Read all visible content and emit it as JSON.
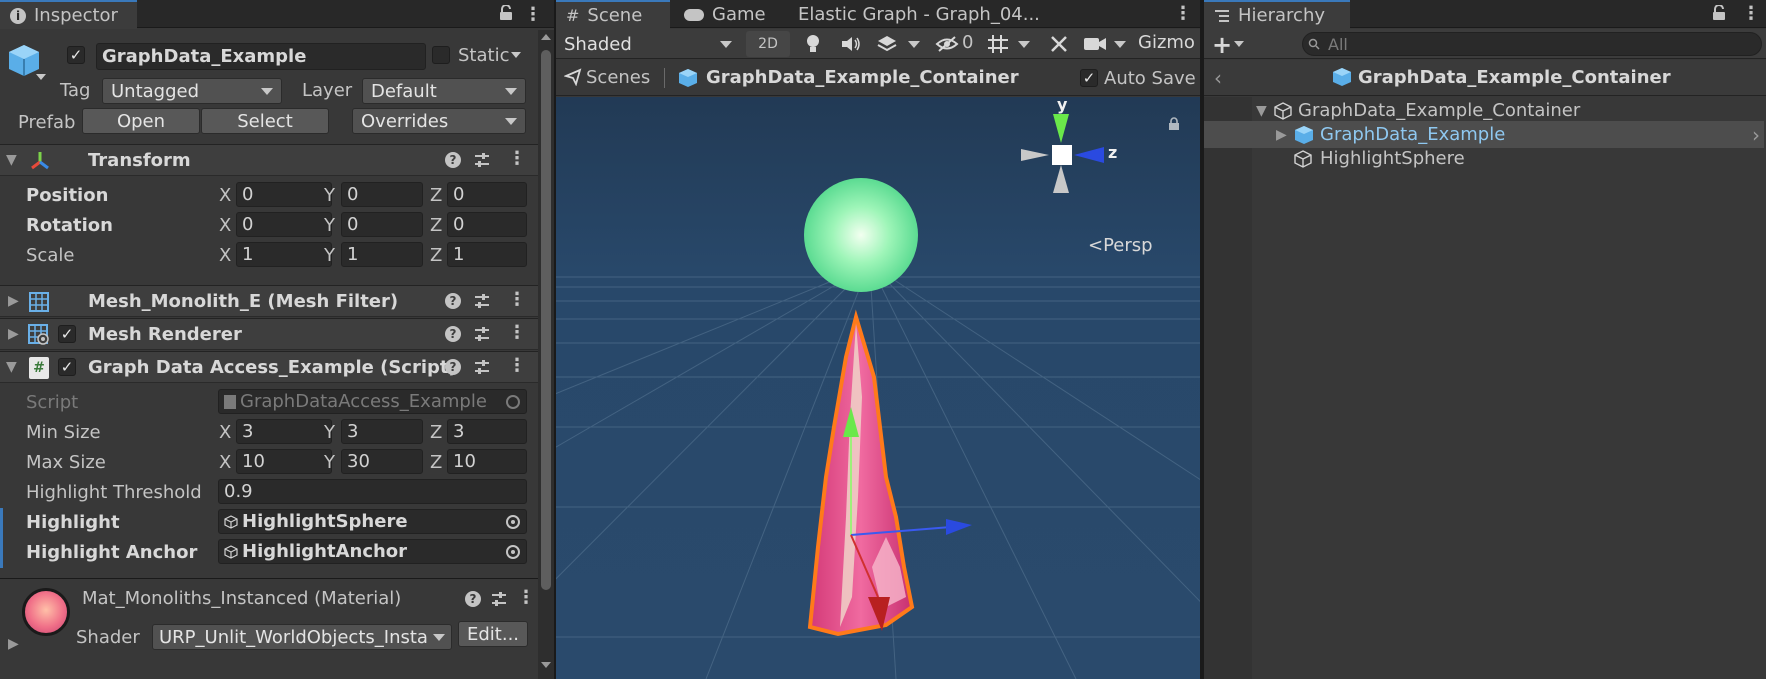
{
  "inspector": {
    "tab_label": "Inspector",
    "object_name": "GraphData_Example",
    "static_label": "Static",
    "tag_label": "Tag",
    "tag_value": "Untagged",
    "layer_label": "Layer",
    "layer_value": "Default",
    "prefab_label": "Prefab",
    "open_label": "Open",
    "select_label": "Select",
    "overrides_label": "Overrides",
    "transform": {
      "title": "Transform",
      "rows": [
        {
          "label": "Position",
          "x": "0",
          "y": "0",
          "z": "0"
        },
        {
          "label": "Rotation",
          "x": "0",
          "y": "0",
          "z": "0"
        },
        {
          "label": "Scale",
          "x": "1",
          "y": "1",
          "z": "1"
        }
      ]
    },
    "axis": {
      "x": "X",
      "y": "Y",
      "z": "Z"
    },
    "mesh_filter_title": "Mesh_Monolith_E (Mesh Filter)",
    "mesh_renderer_title": "Mesh Renderer",
    "script_component": {
      "title": "Graph Data Access_Example (Script)",
      "script_label": "Script",
      "script_value": "GraphDataAccess_Example",
      "min_size_label": "Min Size",
      "min_size": {
        "x": "3",
        "y": "3",
        "z": "3"
      },
      "max_size_label": "Max Size",
      "max_size": {
        "x": "10",
        "y": "30",
        "z": "10"
      },
      "threshold_label": "Highlight Threshold",
      "threshold_value": "0.9",
      "highlight_label": "Highlight",
      "highlight_value": "HighlightSphere",
      "anchor_label": "Highlight Anchor",
      "anchor_value": "HighlightAnchor"
    },
    "material": {
      "title": "Mat_Monoliths_Instanced (Material)",
      "shader_label": "Shader",
      "shader_value": "URP_Unlit_WorldObjects_Instan",
      "edit_label": "Edit..."
    }
  },
  "scene": {
    "tabs": [
      "Scene",
      "Game",
      "Elastic Graph - Graph_04..."
    ],
    "shading_mode": "Shaded",
    "mode_2d": "2D",
    "hidden_count": "0",
    "gizmos_label": "Gizmo",
    "breadcrumb_root": "Scenes",
    "breadcrumb_item": "GraphData_Example_Container",
    "auto_save_label": "Auto Save",
    "gizmo_axes": {
      "y": "y",
      "z": "z"
    },
    "persp_label": "Persp"
  },
  "hierarchy": {
    "tab_label": "Hierarchy",
    "search_placeholder": "All",
    "header_title": "GraphData_Example_Container",
    "items": [
      {
        "label": "GraphData_Example_Container"
      },
      {
        "label": "GraphData_Example"
      },
      {
        "label": "HighlightSphere"
      }
    ]
  },
  "colors": {
    "accent": "#3a79bb",
    "scene_bg": "#2a4a6a",
    "sphere": "#7ef0a0",
    "monolith": "#e8508a",
    "outline": "#ff7a1a",
    "selection": "#4d4d4d"
  }
}
